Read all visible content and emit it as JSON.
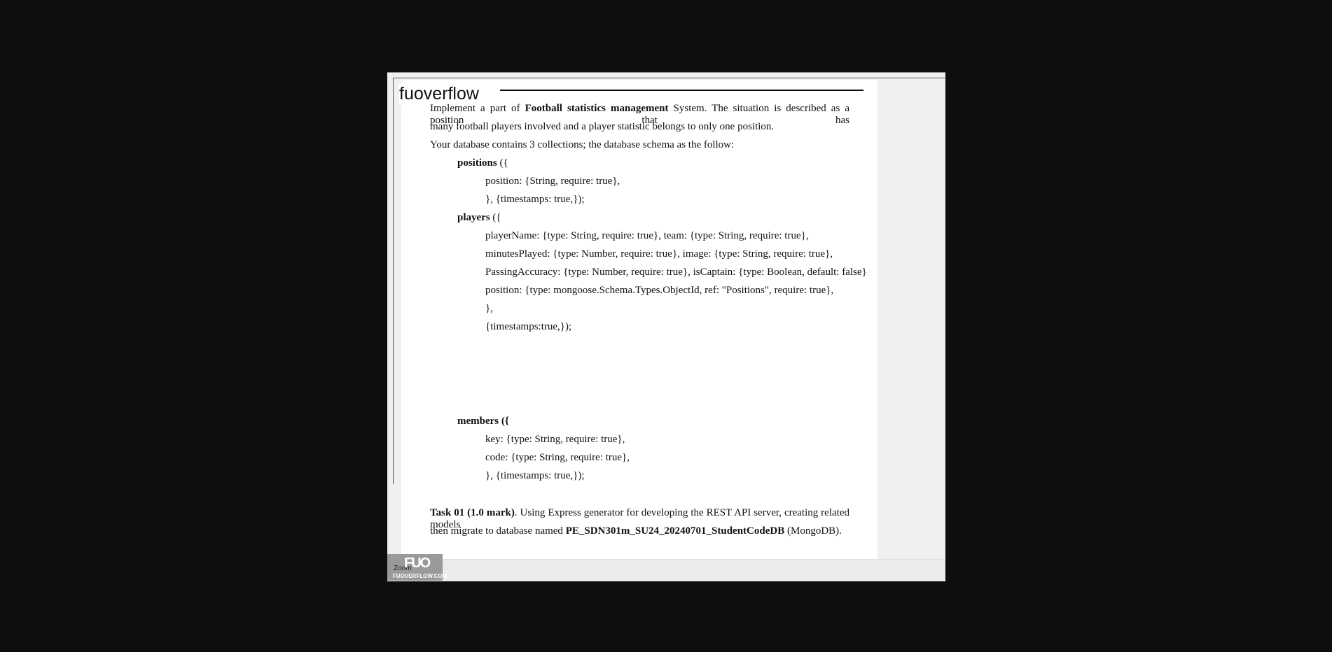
{
  "header": {
    "site_title": "fuoverflow"
  },
  "document": {
    "intro": {
      "p1_a": "Implement a part of ",
      "p1_b": "Football statistics management",
      "p1_c": " System. The situation is described as a position that has",
      "p2": "many football players involved and a player statistic belongs to only one position.",
      "p3": "Your database contains 3 collections; the database schema as the follow:"
    },
    "positions": {
      "name": "positions",
      "open": " ({",
      "lines": [
        "position: {String, require: true},",
        "}, {timestamps: true,});"
      ]
    },
    "players": {
      "name": "players",
      "open": " ({",
      "lines": [
        "playerName: {type: String, require: true}, team: {type: String, require: true},",
        "minutesPlayed: {type: Number, require: true}, image: {type: String, require: true},",
        "PassingAccuracy: {type: Number, require: true}, isCaptain: {type: Boolean, default: false}",
        "position: {type: mongoose.Schema.Types.ObjectId, ref: \"Positions\", require: true},",
        "},",
        "{timestamps:true,});"
      ]
    },
    "members": {
      "name": "members ({",
      "lines": [
        "key: {type: String, require: true},",
        "code: {type: String, require: true},",
        "}, {timestamps: true,});"
      ]
    },
    "task": {
      "label": "Task 01 (1.0 mark)",
      "t1": ". Using Express generator for developing the REST API server, creating related models",
      "t2_a": "then migrate to database named ",
      "db": "PE_SDN301m_SU24_20240701_StudentCodeDB",
      "t2_b": " (MongoDB)."
    }
  },
  "watermark": {
    "logo": "FUO",
    "site": "FUOVERFLOW.COM",
    "zoom_label": "Zoom"
  }
}
